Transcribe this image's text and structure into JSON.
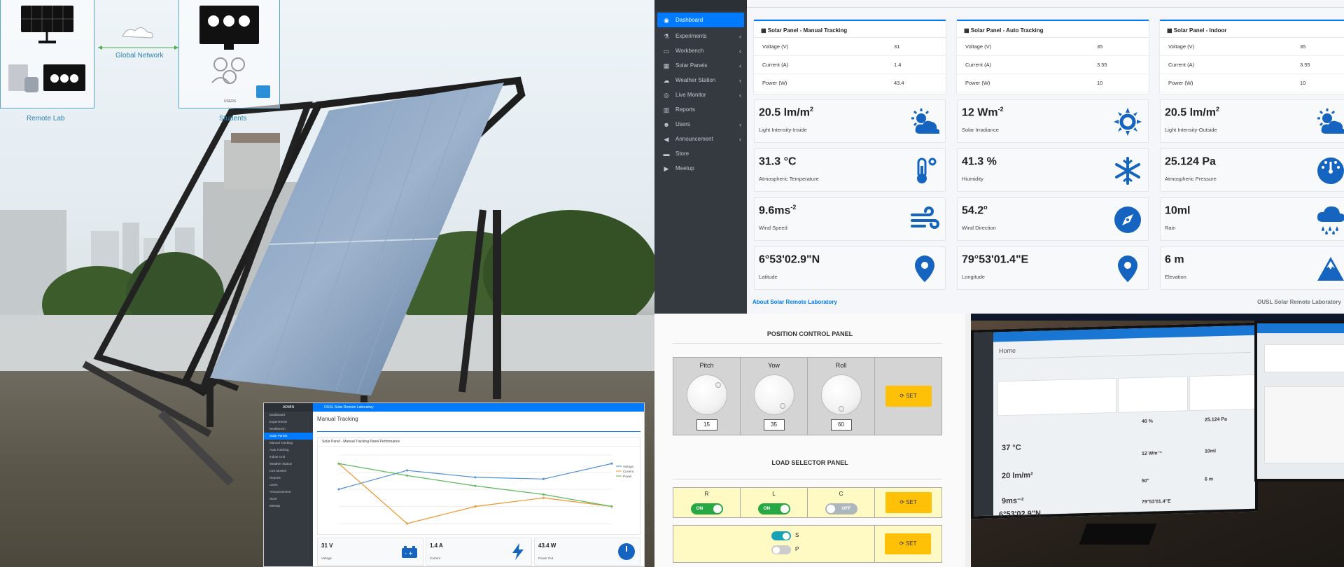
{
  "diagram": {
    "global_network": "Global Network",
    "remote_lab": "Remote Lab",
    "students": "Students",
    "users": "USERS"
  },
  "sidebar": {
    "items": [
      {
        "label": "Dashboard",
        "icon": "dashboard-icon",
        "active": true,
        "chevron": false
      },
      {
        "label": "Experiments",
        "icon": "flask-icon",
        "chevron": true
      },
      {
        "label": "Workbench",
        "icon": "laptop-icon",
        "chevron": true
      },
      {
        "label": "Solar Panels",
        "icon": "solar-panel-icon",
        "chevron": true
      },
      {
        "label": "Weather Station",
        "icon": "cloud-icon",
        "chevron": true
      },
      {
        "label": "Live Monitor",
        "icon": "eye-icon",
        "chevron": true
      },
      {
        "label": "Reports",
        "icon": "chart-icon",
        "chevron": false
      },
      {
        "label": "Users",
        "icon": "users-icon",
        "chevron": true
      },
      {
        "label": "Announcement",
        "icon": "bullhorn-icon",
        "chevron": true
      },
      {
        "label": "Store",
        "icon": "folder-icon",
        "chevron": false
      },
      {
        "label": "Meetup",
        "icon": "video-icon",
        "chevron": false
      }
    ]
  },
  "panels": [
    {
      "title": "Solar Panel - Manual Tracking",
      "rows": [
        [
          "Voltage (V)",
          "31"
        ],
        [
          "Current (A)",
          "1.4"
        ],
        [
          "Power (W)",
          "43.4"
        ]
      ]
    },
    {
      "title": "Solar Panel - Auto Tracking",
      "rows": [
        [
          "Voltage (V)",
          "35"
        ],
        [
          "Current (A)",
          "3.55"
        ],
        [
          "Power (W)",
          "10"
        ]
      ]
    },
    {
      "title": "Solar Panel - Indoor",
      "rows": [
        [
          "Voltage (V)",
          "35"
        ],
        [
          "Current (A)",
          "3.55"
        ],
        [
          "Power (W)",
          "10"
        ]
      ]
    }
  ],
  "tiles": [
    {
      "value": "20.5 lm/m",
      "sup": "2",
      "label": "Light Intensity-Inside",
      "icon": "sun-cloud-icon"
    },
    {
      "value": "12 Wm",
      "sup": "-2",
      "label": "Solar Irradiance",
      "icon": "sun-icon"
    },
    {
      "value": "20.5 lm/m",
      "sup": "2",
      "label": "Light Intensity-Outside",
      "icon": "sun-cloud-icon"
    },
    {
      "value": "31.3 °C",
      "sup": "",
      "label": "Atmospheric Temperature",
      "icon": "thermometer-icon"
    },
    {
      "value": "41.3 %",
      "sup": "",
      "label": "Hiumidity",
      "icon": "snowflake-icon"
    },
    {
      "value": "25.124 Pa",
      "sup": "",
      "label": "Atmospheric Pressure",
      "icon": "gauge-icon"
    },
    {
      "value": "9.6ms",
      "sup": "-2",
      "label": "Wind Speed",
      "icon": "wind-icon"
    },
    {
      "value": "54.2",
      "sup": "o",
      "label": "Wind Direction",
      "icon": "compass-icon"
    },
    {
      "value": "10ml",
      "sup": "",
      "label": "Rain",
      "icon": "rain-icon"
    },
    {
      "value": "6°53'02.9\"N",
      "sup": "",
      "label": "Latitude",
      "icon": "map-pin-icon"
    },
    {
      "value": "79°53'01.4\"E",
      "sup": "",
      "label": "Longitude",
      "icon": "map-pin-icon"
    },
    {
      "value": "6 m",
      "sup": "",
      "label": "Elevation",
      "icon": "mountain-icon"
    }
  ],
  "footer": {
    "left": "About Solar Remote Laboratory",
    "right": "OUSL Solar Remote Laboratory"
  },
  "position_panel": {
    "title": "POSITION CONTROL PANEL",
    "axes": [
      {
        "name": "Pitch",
        "value": "15"
      },
      {
        "name": "Yow",
        "value": "35"
      },
      {
        "name": "Roll",
        "value": "60"
      }
    ],
    "set_label": "SET"
  },
  "load_panel": {
    "title": "LOAD SELECTOR PANEL",
    "toggles": [
      {
        "name": "R",
        "state": "ON"
      },
      {
        "name": "L",
        "state": "ON"
      },
      {
        "name": "C",
        "state": "OFF"
      }
    ],
    "mode_s": "S",
    "mode_p": "P",
    "set_label": "SET"
  },
  "inset": {
    "admin": "ADMIN",
    "topbar": "OUSL Solar Remote Laboratory",
    "page_title": "Manual Tracking",
    "chart_title": "Solar Panel - Manual Tracking Panel Performance",
    "nav": [
      "Dashboard",
      "Experiments",
      "Workbench",
      "Solar Panels",
      "Manual Tracking",
      "Auto Tracking",
      "Indoor Unit",
      "Weather Station",
      "Live Monitor",
      "Reports",
      "Users",
      "Announcement",
      "Store",
      "Meetup"
    ],
    "cards": [
      {
        "value": "31 V",
        "label": "Voltage"
      },
      {
        "value": "1.4 A",
        "label": "Current"
      },
      {
        "value": "43.4 W",
        "label": "Power Out"
      }
    ]
  },
  "chart_data": {
    "type": "line",
    "x": [
      0,
      1,
      2,
      3,
      4
    ],
    "series": [
      {
        "name": "Voltage",
        "color": "#4f8fd6",
        "values": [
          20,
          31,
          27,
          26,
          35
        ]
      },
      {
        "name": "Current",
        "color": "#f0932b",
        "values": [
          35,
          0,
          10,
          15,
          10
        ]
      },
      {
        "name": "Power",
        "color": "#5cb85c",
        "values": [
          35,
          28,
          22,
          17,
          10
        ]
      }
    ],
    "ylim": [
      0,
      40
    ]
  },
  "monitor": {
    "home": "Home",
    "values": [
      "37 °C",
      "40 %",
      "25.124 Pa",
      "20 lm/m²",
      "12 Wm⁻²",
      "10ml",
      "9ms⁻²",
      "50°",
      "6 m",
      "6°53'02.9\"N",
      "79°53'01.4\"E"
    ]
  }
}
